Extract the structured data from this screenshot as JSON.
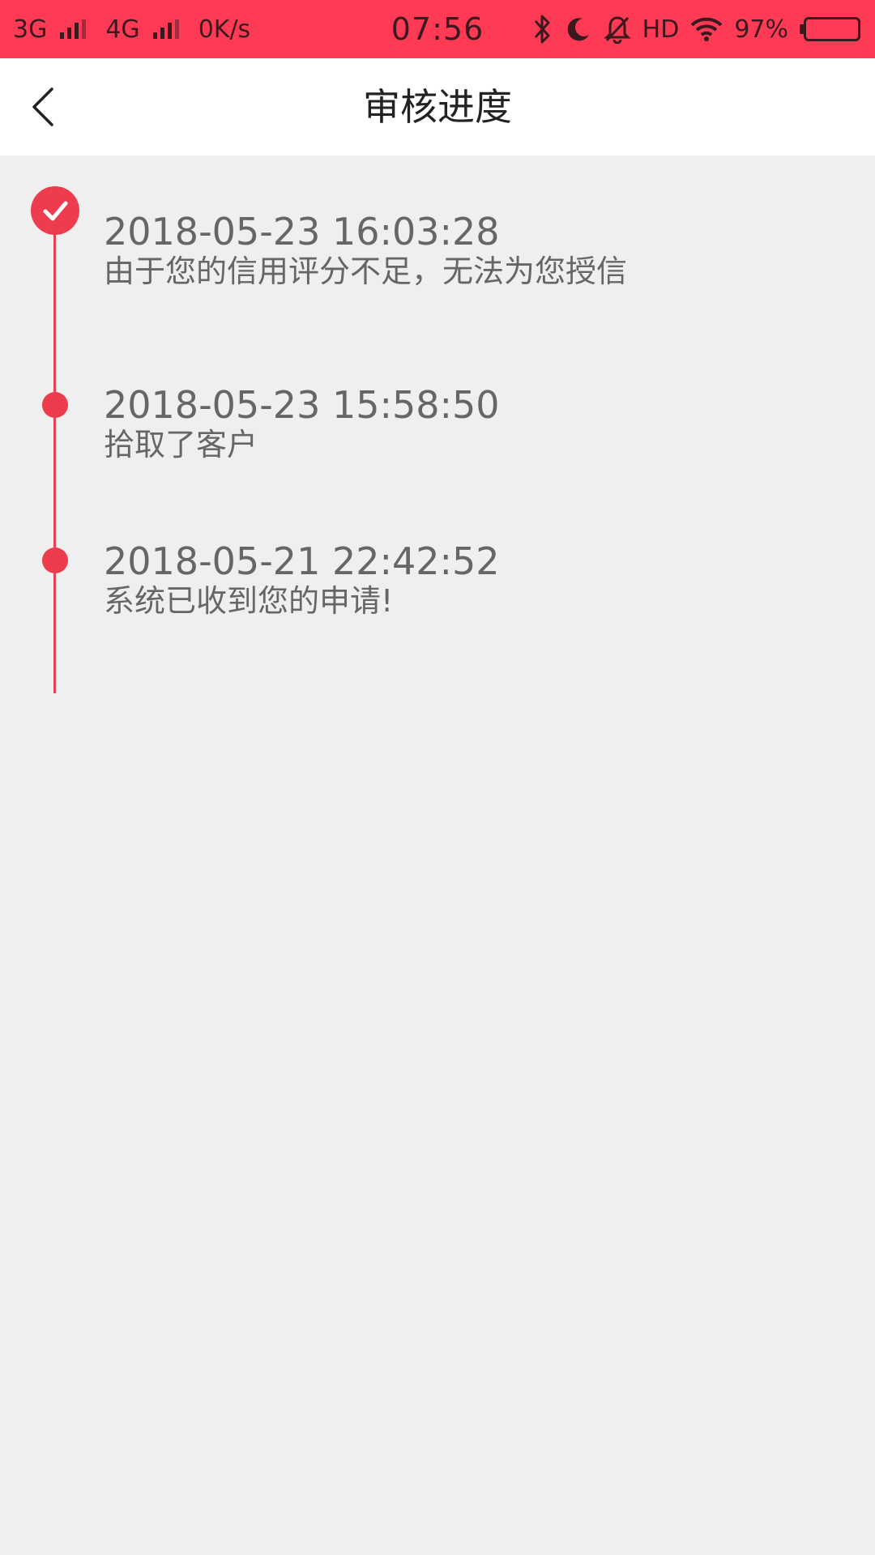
{
  "status_bar": {
    "net1": "3G",
    "net2": "4G",
    "speed": "0K/s",
    "time": "07:56",
    "hd": "HD",
    "battery": "97%",
    "battery_level": 0.97,
    "background_color": "#fe3a55"
  },
  "nav": {
    "back_icon": "chevron-left-icon",
    "title": "审核进度"
  },
  "timeline": {
    "accent_color": "#ee3b4d",
    "items": [
      {
        "time": "2018-05-23 16:03:28",
        "desc": "由于您的信用评分不足，无法为您授信",
        "marker": "check-circle-icon"
      },
      {
        "time": "2018-05-23 15:58:50",
        "desc": "拾取了客户",
        "marker": "dot"
      },
      {
        "time": "2018-05-21 22:42:52",
        "desc": "系统已收到您的申请!",
        "marker": "dot"
      }
    ]
  }
}
